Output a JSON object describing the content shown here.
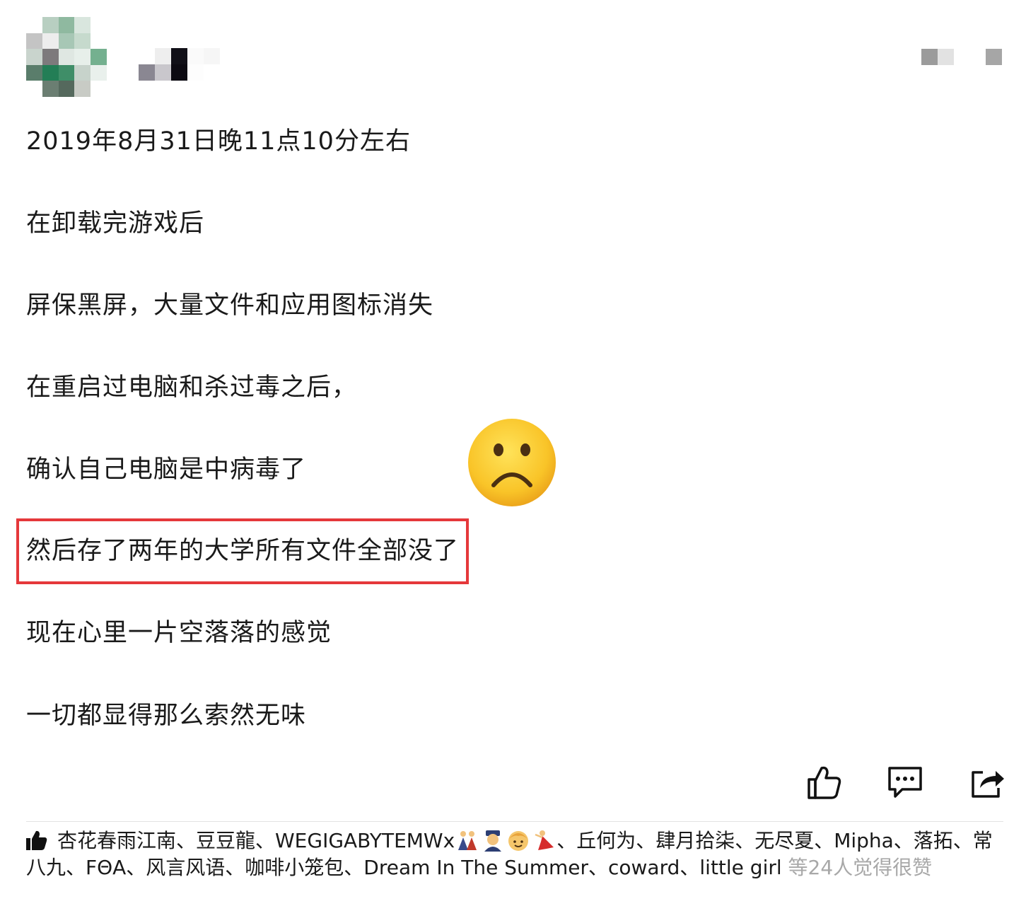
{
  "post": {
    "lines": [
      "2019年8月31日晚11点10分左右",
      "在卸载完游戏后",
      "屏保黑屏，大量文件和应用图标消失",
      "在重启过电脑和杀过毒之后，",
      "确认自己电脑是中病毒了",
      "然后存了两年的大学所有文件全部没了",
      "现在心里一片空落落的感觉",
      "一切都显得那么索然无味"
    ],
    "emoji": "sad-face"
  },
  "actions": {
    "like": "thumbs-up-icon",
    "comment": "comment-icon",
    "share": "share-icon"
  },
  "likes": {
    "names_part1": "杏花春雨江南、豆豆龍、WEGIGABYTEMWx",
    "names_part2": "、丘何为、肆月拾柒、无尽夏、Mipha、落拓、常八九、FΘA、风言风语、咖啡小笼包、Dream In The Summer、coward、little girl",
    "summary": " 等24人觉得很赞"
  },
  "colors": {
    "highlight_border": "#e5383b",
    "muted_text": "#a8a8a8"
  }
}
